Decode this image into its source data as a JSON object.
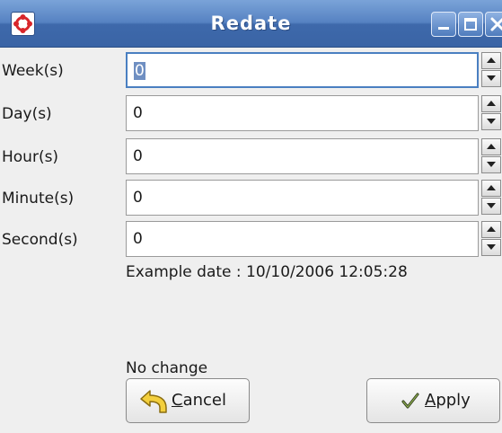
{
  "window": {
    "title": "Redate",
    "controls": [
      "minimize-icon",
      "maximize-icon",
      "close-icon"
    ]
  },
  "fields": [
    {
      "label": "Week(s)",
      "value": "0",
      "focused": true
    },
    {
      "label": "Day(s)",
      "value": "0",
      "focused": false
    },
    {
      "label": "Hour(s)",
      "value": "0",
      "focused": false
    },
    {
      "label": "Minute(s)",
      "value": "0",
      "focused": false
    },
    {
      "label": "Second(s)",
      "value": "0",
      "focused": false
    }
  ],
  "example_text": "Example date : 10/10/2006 12:05:28",
  "status_text": "No change",
  "buttons": {
    "cancel": {
      "mnemonic": "C",
      "rest": "ancel",
      "icon": "undo-icon"
    },
    "apply": {
      "mnemonic": "A",
      "rest": "pply",
      "icon": "checkmark-icon"
    }
  },
  "colors": {
    "titlebar": "#3e69ab",
    "focus_border": "#4a7fc1",
    "selection": "#6f8fc2"
  }
}
